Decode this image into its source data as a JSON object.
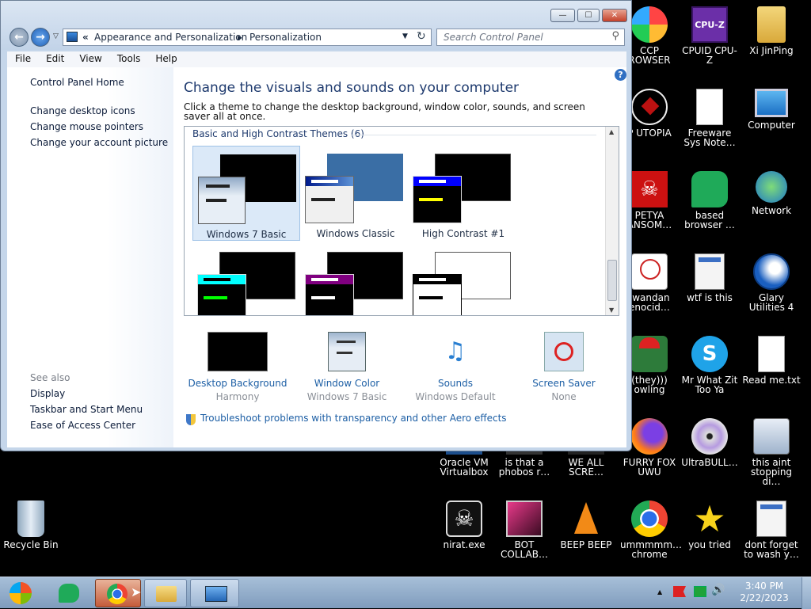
{
  "window": {
    "breadcrumb": {
      "root": "Appearance and Personalization",
      "leaf": "Personalization"
    },
    "search_placeholder": "Search Control Panel",
    "menu": [
      "File",
      "Edit",
      "View",
      "Tools",
      "Help"
    ],
    "left_links": [
      "Control Panel Home",
      "Change desktop icons",
      "Change mouse pointers",
      "Change your account picture"
    ],
    "see_also_header": "See also",
    "see_also_links": [
      "Display",
      "Taskbar and Start Menu",
      "Ease of Access Center"
    ],
    "heading": "Change the visuals and sounds on your computer",
    "subheading": "Click a theme to change the desktop background, window color, sounds, and screen saver all at once.",
    "group_label": "Basic and High Contrast Themes (6)",
    "themes": [
      {
        "name": "Windows 7 Basic",
        "selected": true
      },
      {
        "name": "Windows Classic",
        "selected": false
      },
      {
        "name": "High Contrast #1",
        "selected": false
      },
      {
        "name": "",
        "selected": false
      },
      {
        "name": "",
        "selected": false
      },
      {
        "name": "",
        "selected": false
      }
    ],
    "bottom_items": [
      {
        "title": "Desktop Background",
        "value": "Harmony"
      },
      {
        "title": "Window Color",
        "value": "Windows 7 Basic"
      },
      {
        "title": "Sounds",
        "value": "Windows Default"
      },
      {
        "title": "Screen Saver",
        "value": "None"
      }
    ],
    "troubleshoot_link": "Troubleshoot problems with transparency and other Aero effects",
    "help_glyph": "?"
  },
  "desktop_icons": [
    {
      "label": "CCP ROWSER",
      "icon": "chromium-icon"
    },
    {
      "label": "CPUID CPU-Z",
      "icon": "cpuz-icon"
    },
    {
      "label": "Xi JinPing",
      "icon": "folder-user-icon"
    },
    {
      "label": "P UTOPIA",
      "icon": "utopia-icon"
    },
    {
      "label": "Freeware Sys Note…",
      "icon": "document-icon"
    },
    {
      "label": "Computer",
      "icon": "computer-icon"
    },
    {
      "label": "PETYA ANSOM…",
      "icon": "skull-icon"
    },
    {
      "label": "based browser …",
      "icon": "chat-icon"
    },
    {
      "label": "Network",
      "icon": "network-icon"
    },
    {
      "label": ".wandan enocid…",
      "icon": "meme-icon"
    },
    {
      "label": "wtf is this",
      "icon": "app-window-icon"
    },
    {
      "label": "Glary Utilities 4",
      "icon": "glary-icon"
    },
    {
      "label": "(they))) owling",
      "icon": "gnome-icon"
    },
    {
      "label": "Mr What Zit Too Ya",
      "icon": "skype-icon"
    },
    {
      "label": "Read me.txt",
      "icon": "text-file-icon"
    },
    {
      "label": "Oracle VM Virtualbox",
      "icon": "virtualbox-icon"
    },
    {
      "label": "is that a phobos r…",
      "icon": "file-icon"
    },
    {
      "label": "WE ALL SCRE…",
      "icon": "file-icon"
    },
    {
      "label": "FURRY FOX UWU",
      "icon": "firefox-icon"
    },
    {
      "label": "UltraBULL…",
      "icon": "disc-icon"
    },
    {
      "label": "this aint stopping di…",
      "icon": "installer-icon"
    },
    {
      "label": "Recycle Bin",
      "icon": "recycle-bin-icon"
    },
    {
      "label": "nirat.exe",
      "icon": "skull-icon"
    },
    {
      "label": "BOT COLLAB…",
      "icon": "video-icon"
    },
    {
      "label": "BEEP BEEP",
      "icon": "vlc-icon"
    },
    {
      "label": "ummmmm… chrome",
      "icon": "chrome-icon"
    },
    {
      "label": "you tried",
      "icon": "star-icon"
    },
    {
      "label": "dont forget to wash y…",
      "icon": "app-window-icon"
    }
  ],
  "taskbar": {
    "time": "3:40 PM",
    "date": "2/22/2023",
    "tray_arrow": "▲"
  }
}
